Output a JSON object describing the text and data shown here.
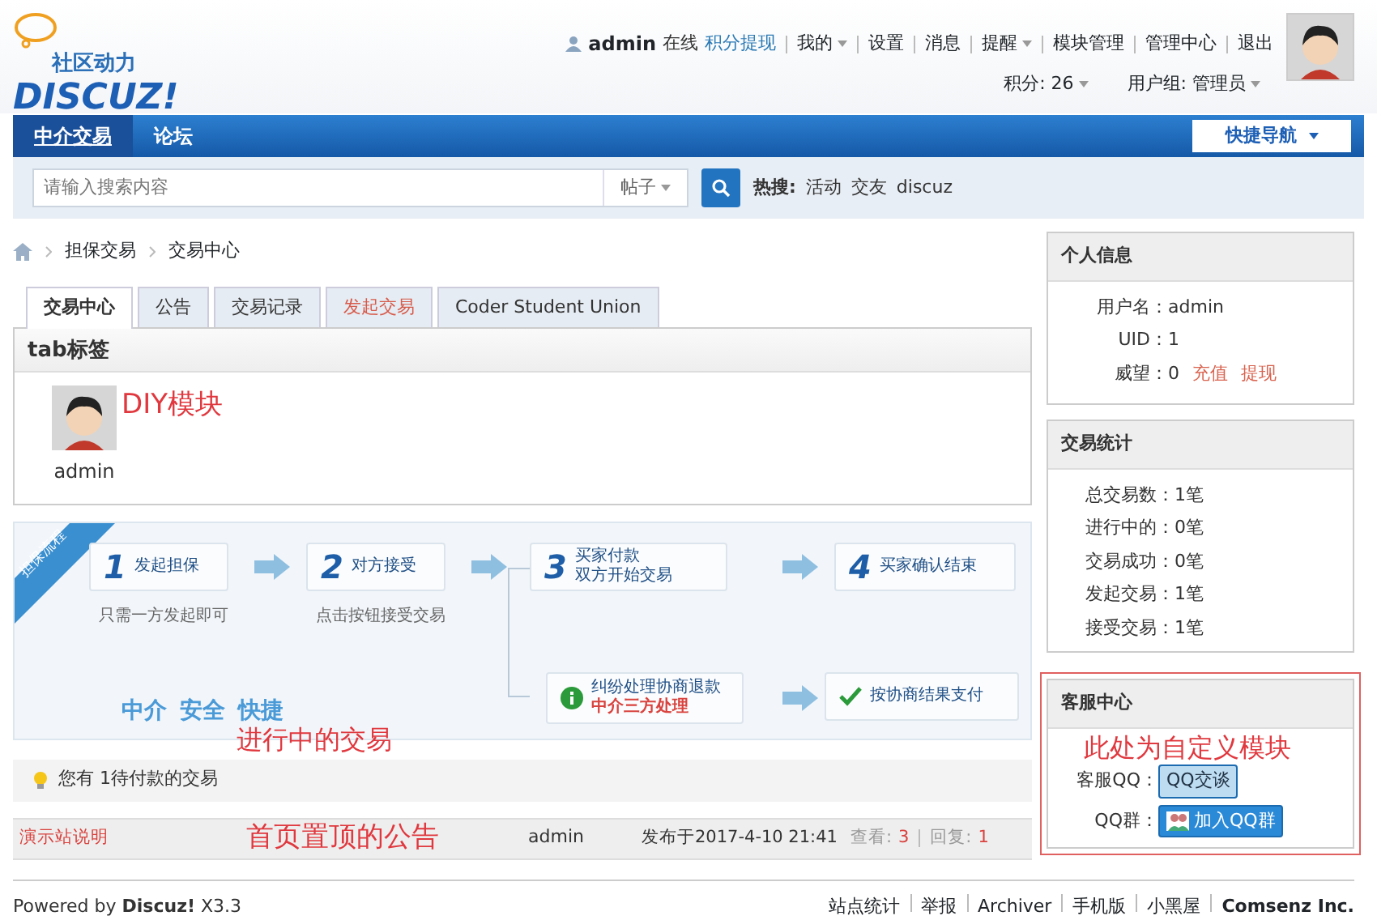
{
  "header": {
    "logo": {
      "tagline": "社区动力",
      "wordmark": "DISCUZ!"
    },
    "user_bar": [
      {
        "kind": "user",
        "label": "admin"
      },
      {
        "kind": "text",
        "label": "在线"
      },
      {
        "kind": "link",
        "label": "积分提现"
      },
      {
        "kind": "menu",
        "label": "我的"
      },
      {
        "kind": "item",
        "label": "设置"
      },
      {
        "kind": "item",
        "label": "消息"
      },
      {
        "kind": "menu",
        "label": "提醒"
      },
      {
        "kind": "item",
        "label": "模块管理"
      },
      {
        "kind": "item",
        "label": "管理中心"
      },
      {
        "kind": "item",
        "label": "退出"
      }
    ],
    "user_stats": [
      "积分: 26",
      "用户组: 管理员"
    ]
  },
  "nav": {
    "items": [
      {
        "label": "中介交易",
        "selected": true
      },
      {
        "label": "论坛",
        "selected": false
      }
    ],
    "quick_nav": "快捷导航"
  },
  "search": {
    "placeholder": "请输入搜索内容",
    "type": "帖子",
    "hot_label": "热搜:",
    "hot": [
      "活动",
      "交友",
      "discuz"
    ]
  },
  "breadcrumb": [
    "担保交易",
    "交易中心"
  ],
  "tabs": [
    {
      "label": "交易中心",
      "selected": true,
      "kind": "normal"
    },
    {
      "label": "公告",
      "selected": false,
      "kind": "normal"
    },
    {
      "label": "交易记录",
      "selected": false,
      "kind": "normal"
    },
    {
      "label": "发起交易",
      "selected": false,
      "kind": "action"
    },
    {
      "label": "Coder Student Union",
      "selected": false,
      "kind": "normal"
    }
  ],
  "block": {
    "title": "tab标签",
    "username": "admin",
    "note": "DIY模块"
  },
  "flow": {
    "ribbon": "担保流程",
    "steps": [
      {
        "number": "1",
        "lines": [
          "发起担保"
        ],
        "caption": "只需一方发起即可"
      },
      {
        "number": "2",
        "lines": [
          "对方接受"
        ],
        "caption": "点击按钮接受交易"
      },
      {
        "number": "3",
        "lines": [
          "买家付款",
          "双方开始交易"
        ]
      },
      {
        "number": "4",
        "lines": [
          "买家确认结束"
        ]
      }
    ],
    "dispute": {
      "title": "纠纷处理协商退款",
      "subtitle": "中介三方处理"
    },
    "result": "按协商结果支付",
    "slogan": [
      "中介",
      "安全",
      "快捷"
    ],
    "note": "进行中的交易"
  },
  "pending": "您有 1待付款的交易",
  "announcement": {
    "title": "演示站说明",
    "note": "首页置顶的公告",
    "author": "admin",
    "date": "发布于2017-4-10 21:41",
    "views_label": "查看:",
    "views": "3",
    "replies_label": "回复:",
    "replies": "1"
  },
  "sidebar": {
    "profile": {
      "title": "个人信息",
      "rows": [
        {
          "label": "用户名：",
          "value": "admin"
        },
        {
          "label": "UID：",
          "value": "1"
        },
        {
          "label": "威望：",
          "value": "0",
          "links": [
            "充值",
            "提现"
          ]
        }
      ]
    },
    "stats": {
      "title": "交易统计",
      "rows": [
        {
          "label": "总交易数：",
          "value": "1笔"
        },
        {
          "label": "进行中的：",
          "value": "0笔"
        },
        {
          "label": "交易成功：",
          "value": "0笔"
        },
        {
          "label": "发起交易：",
          "value": "1笔"
        },
        {
          "label": "接受交易：",
          "value": "1笔"
        }
      ]
    },
    "service": {
      "title": "客服中心",
      "qq_label": "客服QQ：",
      "qq_button": "QQ交谈",
      "group_label": "QQ群：",
      "group_button": "加入QQ群",
      "note": "此处为自定义模块"
    }
  },
  "footer": {
    "powered": "Powered by **Discuz!** X3.3",
    "links": [
      "站点统计",
      "举报",
      "Archiver",
      "手机版",
      "小黑屋",
      "Comsenz Inc."
    ]
  }
}
